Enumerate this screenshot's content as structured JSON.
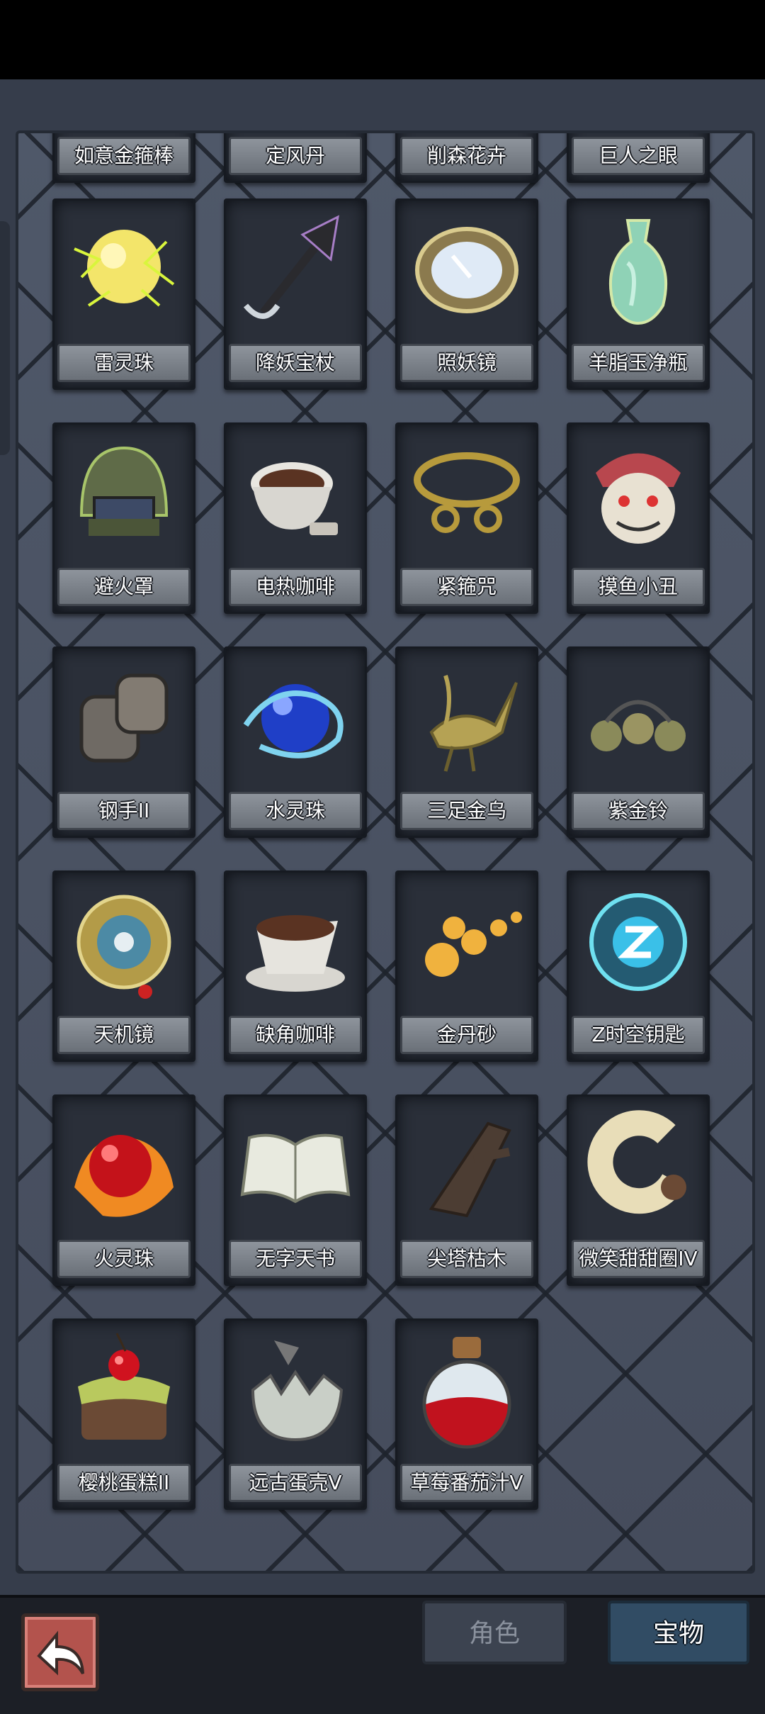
{
  "tabs": {
    "role_label": "角色",
    "treasure_label": "宝物",
    "active": "宝物"
  },
  "top_row_partial": [
    "如意金箍棒",
    "定风丹",
    "削森花卉",
    "巨人之眼"
  ],
  "items": [
    {
      "name": "雷灵珠",
      "icon": "thunder-orb-icon"
    },
    {
      "name": "降妖宝杖",
      "icon": "demon-staff-icon"
    },
    {
      "name": "照妖镜",
      "icon": "demon-mirror-icon"
    },
    {
      "name": "羊脂玉净瓶",
      "icon": "jade-vase-icon"
    },
    {
      "name": "避火罩",
      "icon": "fire-helmet-icon"
    },
    {
      "name": "电热咖啡",
      "icon": "electric-coffee-icon"
    },
    {
      "name": "紧箍咒",
      "icon": "golden-headband-icon"
    },
    {
      "name": "摸鱼小丑",
      "icon": "jester-mask-icon"
    },
    {
      "name": "钢手II",
      "icon": "steel-gauntlet-icon"
    },
    {
      "name": "水灵珠",
      "icon": "water-orb-icon"
    },
    {
      "name": "三足金乌",
      "icon": "golden-crow-icon"
    },
    {
      "name": "紫金铃",
      "icon": "purple-gold-bells-icon"
    },
    {
      "name": "天机镜",
      "icon": "bagua-mirror-icon"
    },
    {
      "name": "缺角咖啡",
      "icon": "broken-coffee-icon"
    },
    {
      "name": "金丹砂",
      "icon": "golden-pills-icon"
    },
    {
      "name": "Z时空钥匙",
      "icon": "z-spacetime-key-icon"
    },
    {
      "name": "火灵珠",
      "icon": "fire-orb-icon"
    },
    {
      "name": "无字天书",
      "icon": "blank-book-icon"
    },
    {
      "name": "尖塔枯木",
      "icon": "dead-wood-icon"
    },
    {
      "name": "微笑甜甜圈IV",
      "icon": "donut-icon"
    },
    {
      "name": "樱桃蛋糕II",
      "icon": "cherry-cake-icon"
    },
    {
      "name": "远古蛋壳V",
      "icon": "ancient-eggshell-icon"
    },
    {
      "name": "草莓番茄汁V",
      "icon": "juice-potion-icon"
    }
  ]
}
